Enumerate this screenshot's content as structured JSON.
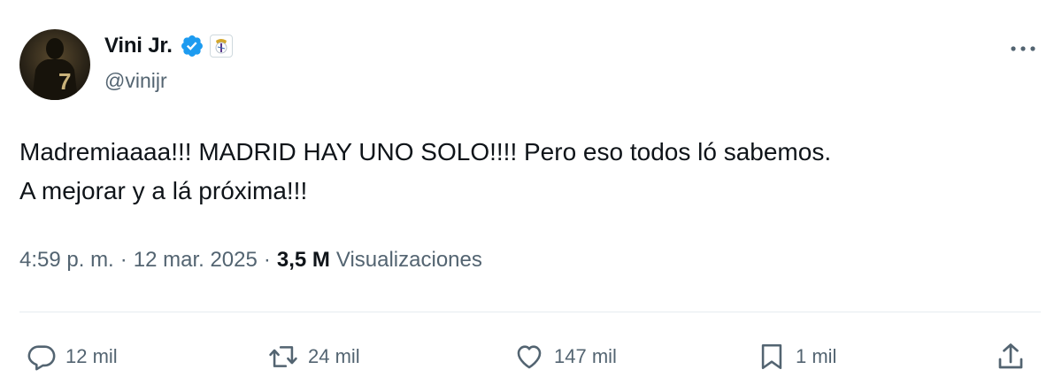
{
  "author": {
    "display_name": "Vini Jr.",
    "handle": "@vinijr",
    "verified": true,
    "verified_color": "#1d9bf0",
    "avatar_jersey_number": "7"
  },
  "tweet": {
    "text": "Madremiaaaa!!! MADRID HAY UNO SOLO!!!! Pero eso todos ló sabemos.\nA mejorar y a lá próxima!!!",
    "time": "4:59 p. m.",
    "separator": "·",
    "date": "12 mar. 2025",
    "views_count": "3,5 M",
    "views_label": "Visualizaciones"
  },
  "actions": {
    "replies": "12 mil",
    "retweets": "24 mil",
    "likes": "147 mil",
    "bookmarks": "1 mil"
  },
  "colors": {
    "text_primary": "#0f1419",
    "text_secondary": "#536471",
    "divider": "#e6ecf0"
  }
}
